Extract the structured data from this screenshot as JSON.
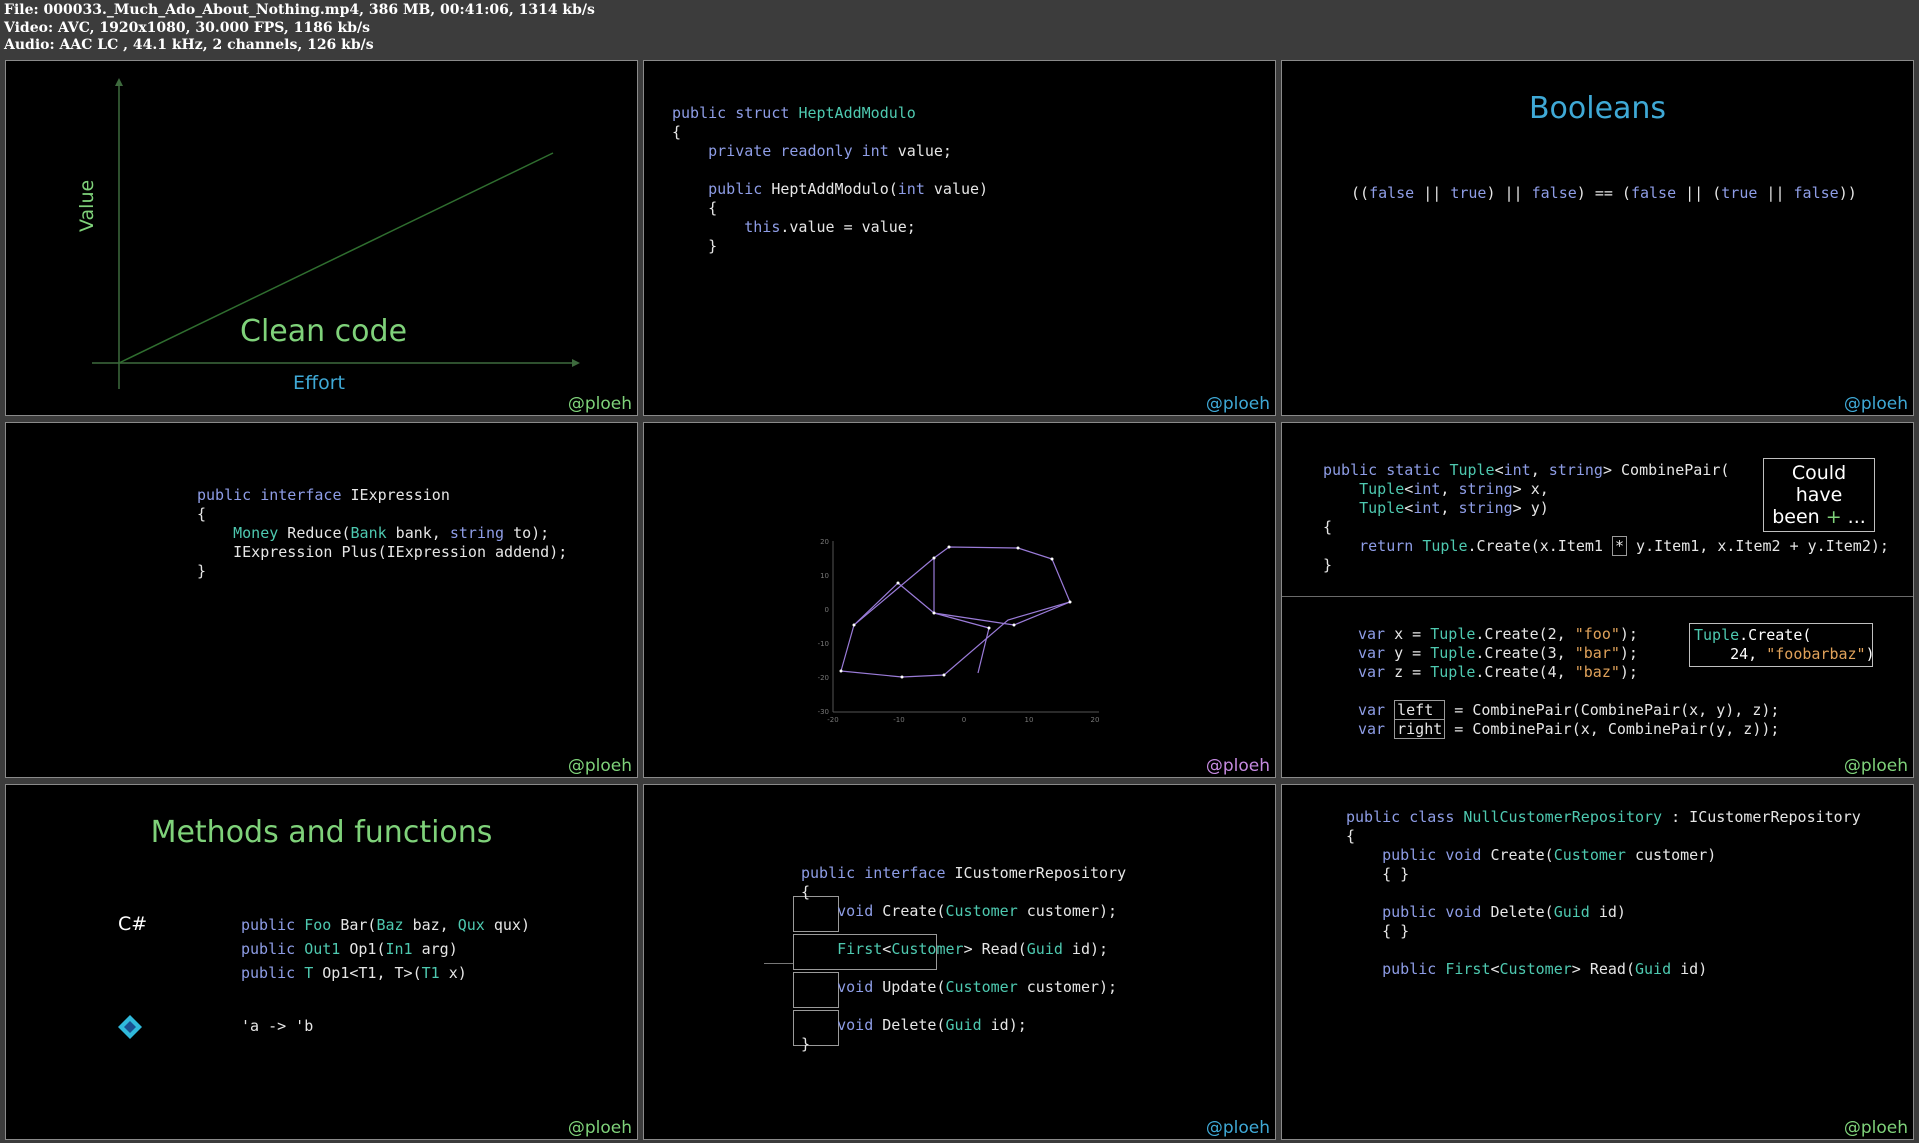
{
  "header": {
    "file_line": "File: 000033._Much_Ado_About_Nothing.mp4, 386 MB, 00:41:06, 1314 kb/s",
    "video_line": "Video: AVC, 1920x1080, 30.000 FPS, 1186 kb/s",
    "audio_line": "Audio: AAC LC , 44.1 kHz, 2 channels, 126 kb/s"
  },
  "handle": "@ploeh",
  "colors": {
    "green": "#7fd27a",
    "blue": "#3fa9d6",
    "purple": "#c58ae0"
  },
  "tile1": {
    "title": "Clean code",
    "xlabel": "Effort",
    "ylabel": "Value"
  },
  "tile2": {
    "lines": [
      "public struct HeptAddModulo",
      "{",
      "    private readonly int value;",
      "",
      "    public HeptAddModulo(int value)",
      "    {",
      "        this.value = value;",
      "    }"
    ]
  },
  "tile3": {
    "title": "Booleans",
    "expr": "((false || true) || false) == (false || (true || false))"
  },
  "tile4": {
    "lines": [
      "public interface IExpression",
      "{",
      "    Money Reduce(Bank bank, string to);",
      "    IExpression Plus(IExpression addend);",
      "}"
    ]
  },
  "tile5": {
    "x_ticks": [
      "-20",
      "-10",
      "0",
      "10",
      "20"
    ],
    "y_ticks": [
      "20",
      "10",
      "0",
      "-10",
      "-20",
      "-30"
    ]
  },
  "tile6": {
    "upper_lines": [
      "public static Tuple<int, string> CombinePair(",
      "    Tuple<int, string> x,",
      "    Tuple<int, string> y)",
      "{",
      "    return Tuple.Create(x.Item1 * y.Item1, x.Item2 + y.Item2);",
      "}"
    ],
    "callout1_line1": "Could have",
    "callout1_line2": "been + ...",
    "lower_lines": [
      "var x = Tuple.Create(2, \"foo\");",
      "var y = Tuple.Create(3, \"bar\");",
      "var z = Tuple.Create(4, \"baz\");",
      "",
      "var left  = CombinePair(CombinePair(x, y), z);",
      "var right = CombinePair(x, CombinePair(y, z));"
    ],
    "callout2_line1": "Tuple.Create(",
    "callout2_line2": "    24, \"foobarbaz\")"
  },
  "tile7": {
    "title": "Methods and functions",
    "csharp_label": "C#",
    "csharp_lines": [
      "public Foo Bar(Baz baz, Qux qux)",
      "public Out1 Op1(In1 arg)",
      "public T Op1<T1, T>(T1 x)"
    ],
    "fsharp_line": "'a -> 'b",
    "fsharp_icon": "fsharp-logo-icon"
  },
  "tile8": {
    "lines": [
      "public interface ICustomerRepository",
      "{",
      "    void Create(Customer customer);",
      "",
      "    First<Customer> Read(Guid id);",
      "",
      "    void Update(Customer customer);",
      "",
      "    void Delete(Guid id);",
      "}"
    ]
  },
  "tile9": {
    "lines": [
      "public class NullCustomerRepository : ICustomerRepository",
      "{",
      "    public void Create(Customer customer)",
      "    { }",
      "",
      "    public void Delete(Guid id)",
      "    { }",
      "",
      "    public First<Customer> Read(Guid id)"
    ]
  }
}
